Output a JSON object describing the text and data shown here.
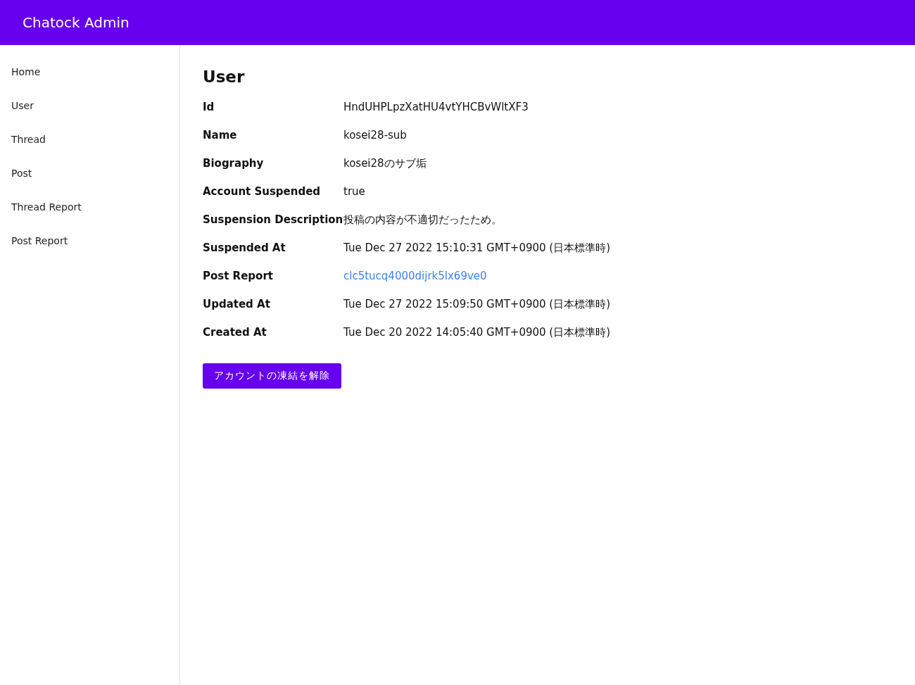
{
  "header": {
    "title": "Chatock Admin"
  },
  "sidebar": {
    "items": [
      {
        "label": "Home"
      },
      {
        "label": "User"
      },
      {
        "label": "Thread"
      },
      {
        "label": "Post"
      },
      {
        "label": "Thread Report"
      },
      {
        "label": "Post Report"
      }
    ]
  },
  "detail": {
    "title": "User",
    "fields": [
      {
        "label": "Id",
        "value": "HndUHPLpzXatHU4vtYHCBvWltXF3",
        "kind": "text"
      },
      {
        "label": "Name",
        "value": "kosei28-sub",
        "kind": "text"
      },
      {
        "label": "Biography",
        "value": "kosei28のサブ垢",
        "kind": "text"
      },
      {
        "label": "Account Suspended",
        "value": "true",
        "kind": "text"
      },
      {
        "label": "Suspension Description",
        "value": "投稿の内容が不適切だったため。",
        "kind": "text"
      },
      {
        "label": "Suspended At",
        "value": "Tue Dec 27 2022 15:10:31 GMT+0900 (日本標準時)",
        "kind": "text"
      },
      {
        "label": "Post Report",
        "value": "clc5tucq4000dijrk5lx69ve0",
        "kind": "link"
      },
      {
        "label": "Updated At",
        "value": "Tue Dec 27 2022 15:09:50 GMT+0900 (日本標準時)",
        "kind": "text"
      },
      {
        "label": "Created At",
        "value": "Tue Dec 20 2022 14:05:40 GMT+0900 (日本標準時)",
        "kind": "text"
      }
    ],
    "button": "アカウントの凍結を解除"
  }
}
